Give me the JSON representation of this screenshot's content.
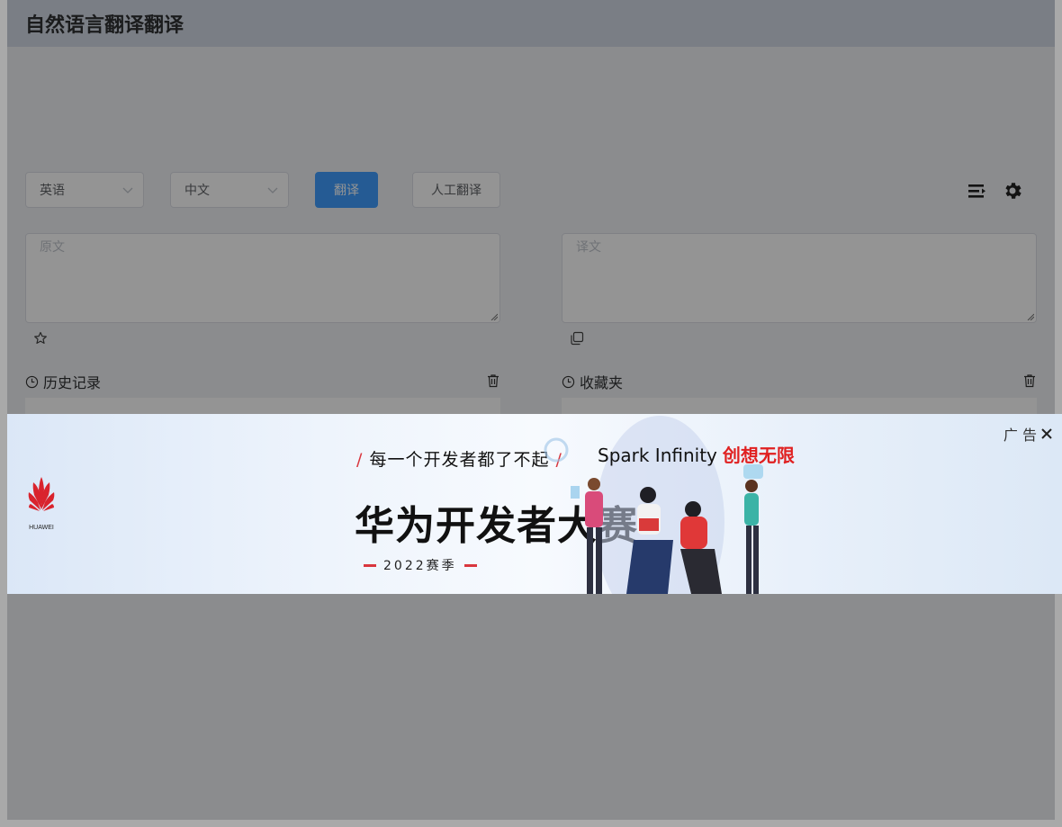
{
  "header": {
    "title": "自然语言翻译翻译"
  },
  "toolbar": {
    "source_lang": "英语",
    "target_lang": "中文",
    "translate_label": "翻译",
    "human_translate_label": "人工翻译"
  },
  "source": {
    "placeholder": "原文"
  },
  "target": {
    "placeholder": "译文"
  },
  "history": {
    "title": "历史记录"
  },
  "favorites": {
    "title": "收藏夹"
  },
  "ad": {
    "label": "广 告",
    "logo_text": "HUAWEI",
    "slogan": "每一个开发者都了不起",
    "title": "华为开发者大赛",
    "season": "2022赛季",
    "brand": "Spark Infinity",
    "brand_cn": "创想无限"
  },
  "colors": {
    "primary": "#409eff",
    "huawei_red": "#e02020",
    "overlay": "rgba(0,0,0,0.42)"
  }
}
